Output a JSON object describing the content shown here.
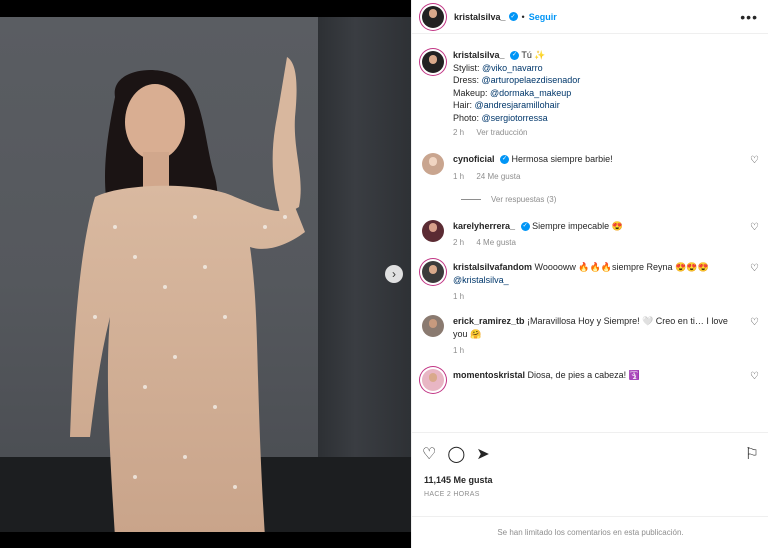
{
  "post": {
    "author": "kristalsilva_",
    "follow_label": "Seguir",
    "dot": "•",
    "more": "•••"
  },
  "caption": {
    "author": "kristalsilva_",
    "title": "Tú ✨",
    "lines": [
      {
        "label": "Stylist: ",
        "mention": "@viko_navarro"
      },
      {
        "label": "Dress: ",
        "mention": "@arturopelaezdisenador"
      },
      {
        "label": "Makeup: ",
        "mention": "@dormaka_makeup"
      },
      {
        "label": "Hair: ",
        "mention": "@andresjaramillohair"
      },
      {
        "label": "Photo: ",
        "mention": "@sergiotorressa"
      }
    ],
    "time": "2 h",
    "translate": "Ver traducción"
  },
  "comments": [
    {
      "user": "cynoficial",
      "verified": true,
      "text": "Hermosa siempre barbie!",
      "time": "1 h",
      "likes": "24 Me gusta",
      "replies": "Ver respuestas (3)"
    },
    {
      "user": "karelyherrera_",
      "verified": true,
      "text": "Siempre impecable 😍",
      "time": "2 h",
      "likes": "4 Me gusta"
    },
    {
      "user": "kristalsilvafandom",
      "verified": false,
      "text": "Wooooww 🔥🔥🔥siempre Reyna 😍😍😍",
      "mention": "@kristalsilva_",
      "time": "1 h"
    },
    {
      "user": "erick_ramirez_tb",
      "verified": false,
      "text": "¡Maravillosa Hoy y Siempre! 🤍 Creo en ti… I love you 🤗",
      "time": "1 h"
    },
    {
      "user": "momentoskristal",
      "verified": false,
      "text": "Diosa, de pies a cabeza! 🛐"
    }
  ],
  "actions": {
    "likes": "11,145 Me gusta",
    "ago": "HACE 2 HORAS",
    "limited": "Se han limitado los comentarios en esta publicación."
  },
  "icons": {
    "like": "heart-icon",
    "comment": "comment-icon",
    "share": "share-icon",
    "save": "bookmark-icon",
    "next": "chevron-right-icon"
  },
  "colors": {
    "accent": "#0095f6",
    "mention": "#00376b",
    "muted": "#8e8e8e"
  }
}
